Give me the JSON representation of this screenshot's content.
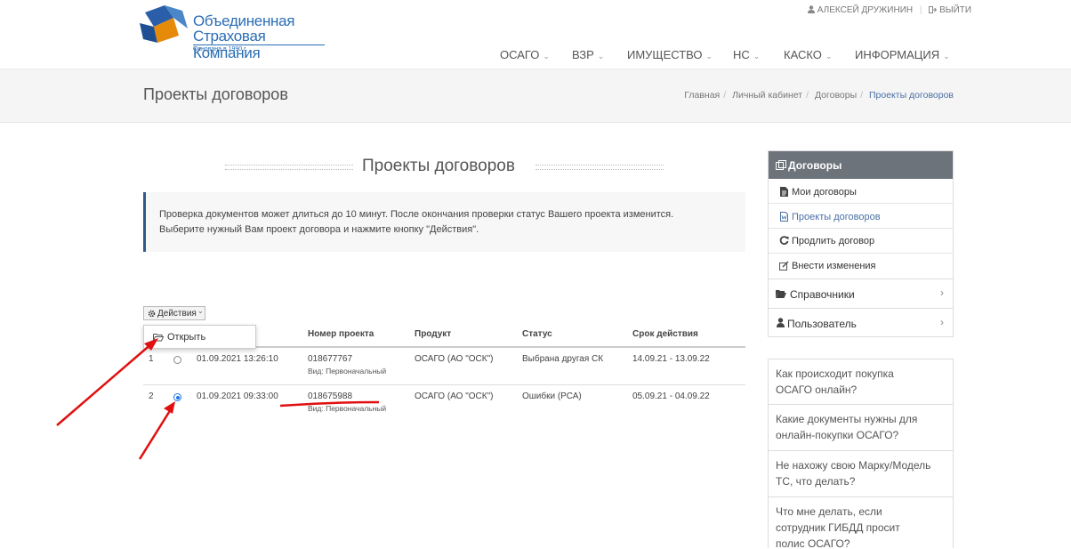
{
  "header": {
    "logo_line1": "Объединенная",
    "logo_line2": "Страховая Компания",
    "logo_sub": "Основана в 1990 г.",
    "user_name": "АЛЕКСЕЙ ДРУЖИНИН",
    "logout": "ВЫЙТИ",
    "nav": [
      "ОСАГО",
      "ВЗР",
      "ИМУЩЕСТВО",
      "НС",
      "КАСКО",
      "ИНФОРМАЦИЯ"
    ]
  },
  "band": {
    "title": "Проекты договоров",
    "breadcrumb": [
      "Главная",
      "Личный кабинет",
      "Договоры",
      "Проекты договоров"
    ]
  },
  "main": {
    "section_title": "Проекты договоров",
    "info_line1": "Проверка документов может длиться до 10 минут. После окончания проверки статус Вашего проекта изменится.",
    "info_line2": "Выберите нужный Вам проект договора и нажмите кнопку \"Действия\".",
    "actions_label": "Действия",
    "dropdown_open": "Открыть",
    "columns": [
      "Номер проекта",
      "Продукт",
      "Статус",
      "Срок действия"
    ],
    "rows": [
      {
        "n": "1",
        "date": "01.09.2021 13:26:10",
        "number": "018677767",
        "kind": "Вид: Первоначальный",
        "product": "ОСАГО (АО \"ОСК\")",
        "status": "Выбрана другая СК",
        "period": "14.09.21 - 13.09.22",
        "selected": false
      },
      {
        "n": "2",
        "date": "01.09.2021 09:33:00",
        "number": "018675988",
        "kind": "Вид: Первоначальный",
        "product": "ОСАГО (АО \"ОСК\")",
        "status": "Ошибки (РСА)",
        "period": "05.09.21 - 04.09.22",
        "selected": true
      }
    ]
  },
  "sidebar": {
    "head": "Договоры",
    "items": [
      "Мои договоры",
      "Проекты договоров",
      "Продлить договор",
      "Внести изменения"
    ],
    "groups": [
      "Справочники",
      "Пользователь"
    ]
  },
  "faq": [
    "Как происходит покупка ОСАГО онлайн?",
    "Какие документы нужны для онлайн-покупки ОСАГО?",
    "Не нахожу свою Марку/Модель ТС, что делать?",
    "Что мне делать, если сотрудник ГИБДД просит полис ОСАГО?"
  ],
  "colors": {
    "brand": "#2a6db5",
    "sidebar_head": "#6d737b",
    "info_border": "#2e5b8a",
    "annotation": "#e01010"
  }
}
